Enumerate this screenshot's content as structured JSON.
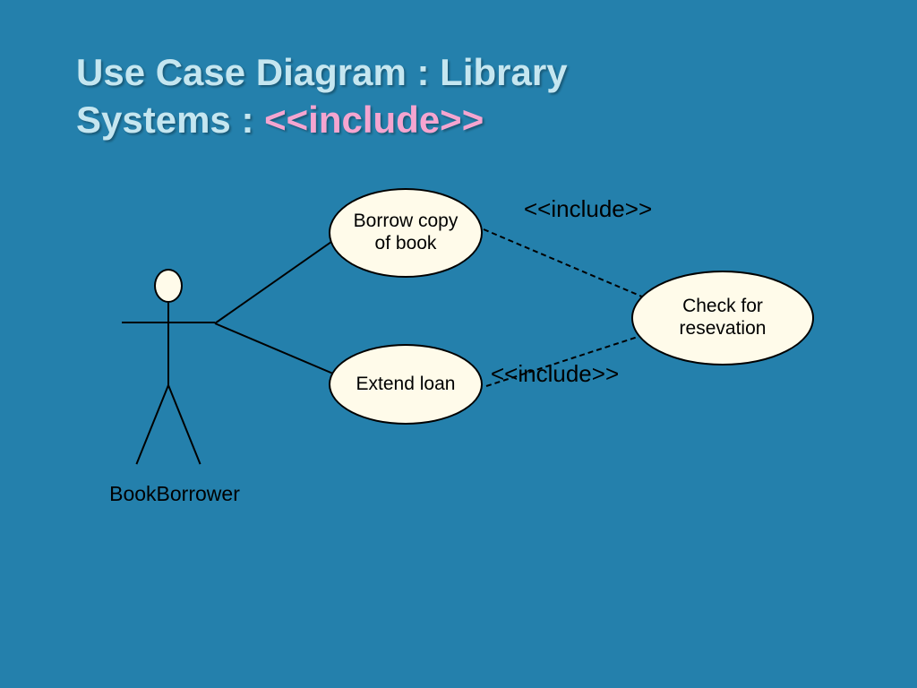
{
  "title": {
    "line1": "Use Case Diagram : Library",
    "line2_prefix": "Systems : ",
    "accent": "<<include>>"
  },
  "diagram": {
    "actor": "BookBorrower",
    "usecases": {
      "borrow": "Borrow copy of book",
      "extend": "Extend loan",
      "check": "Check for resevation"
    },
    "include_stereotype": "<<include>>",
    "relations": [
      {
        "from": "BookBorrower",
        "to": "Borrow copy of book",
        "type": "association"
      },
      {
        "from": "BookBorrower",
        "to": "Extend loan",
        "type": "association"
      },
      {
        "from": "Borrow copy of book",
        "to": "Check for resevation",
        "type": "include"
      },
      {
        "from": "Extend loan",
        "to": "Check for resevation",
        "type": "include"
      }
    ]
  }
}
